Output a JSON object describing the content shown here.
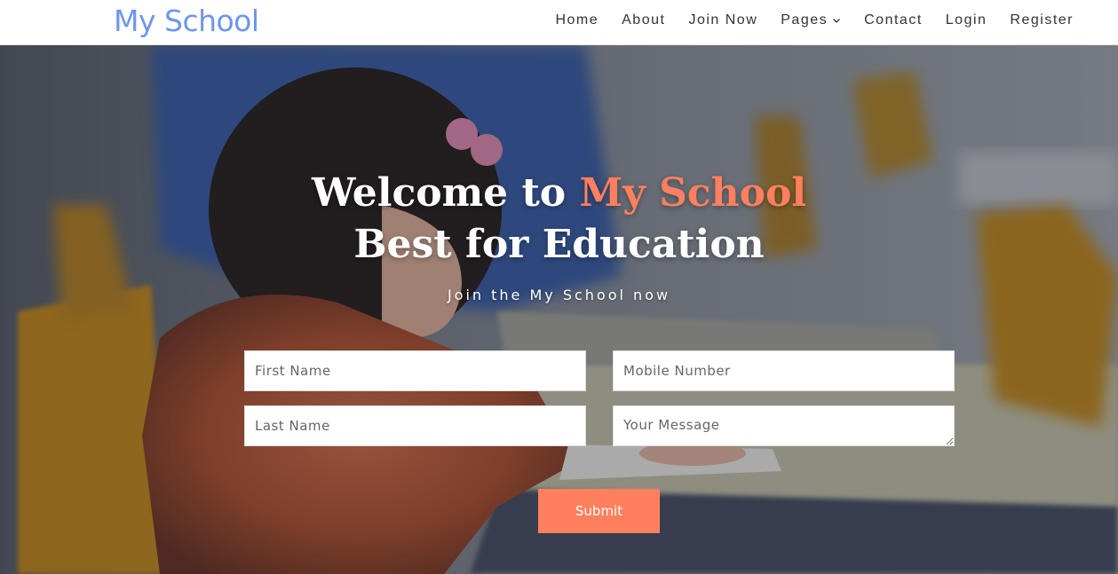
{
  "header": {
    "brand": "My School",
    "nav": [
      {
        "label": "Home"
      },
      {
        "label": "About"
      },
      {
        "label": "Join Now"
      },
      {
        "label": "Pages"
      },
      {
        "label": "Contact"
      },
      {
        "label": "Login"
      },
      {
        "label": "Register"
      }
    ]
  },
  "hero": {
    "title_prefix": "Welcome to ",
    "title_accent": "My School",
    "title_line2": "Best for Education",
    "subtitle": "Join the My School now",
    "form": {
      "first_name_placeholder": "First Name",
      "last_name_placeholder": "Last Name",
      "mobile_placeholder": "Mobile Number",
      "message_placeholder": "Your Message",
      "submit_label": "Submit"
    }
  },
  "colors": {
    "brand": "#6f95ec",
    "accent": "#ff7f5e"
  }
}
